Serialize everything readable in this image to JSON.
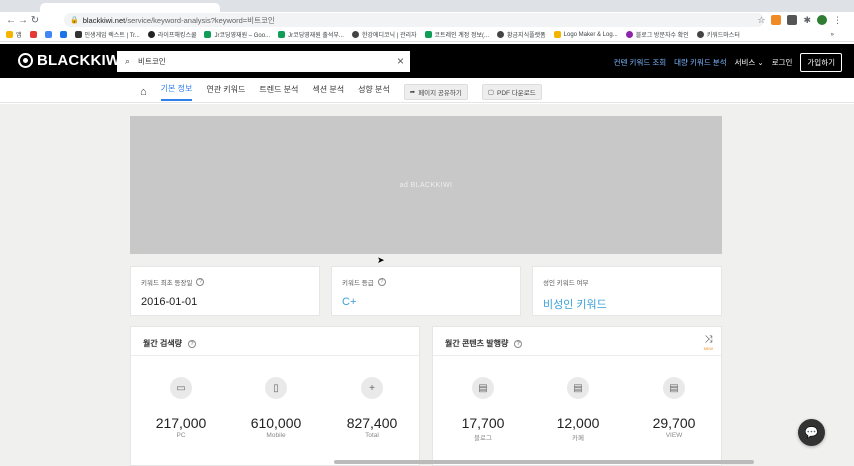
{
  "browser": {
    "url_domain": "blackkiwi.net",
    "url_path": "/service/keyword-analysis?keyword=비트코인",
    "bookmarks": [
      "앱",
      "인생게임 렉스트 | Tr...",
      "라이프해킹스쿨",
      "Jr코딩영재원 – Goo...",
      "Jr코딩영재원 출석부...",
      "한강에디코닉 | 관리자",
      "코트레인 계정 정보(...",
      "황금지식플랫폼",
      "Logo Maker & Log...",
      "블로그 방문자수 확인",
      "키워드마스터"
    ],
    "more_label": "»"
  },
  "header": {
    "logo_text": "BLACKKIWI",
    "search_value": "비트코인",
    "links": [
      "컨텐 키워드 조회",
      "대량 키워드 분석",
      "서비스 ⌄",
      "로그인"
    ],
    "join_label": "가입하기"
  },
  "tabs": {
    "items": [
      "기본 정보",
      "연관 키워드",
      "트렌드 분석",
      "섹션 분석",
      "성향 분석"
    ],
    "active_index": 0,
    "share_label": "페이지 공유하기",
    "pdf_label": "PDF 다운로드"
  },
  "ad": {
    "label": "ad BLACKKIWI"
  },
  "info_cards": [
    {
      "label": "키워드 최초 등장일",
      "value": "2016-01-01"
    },
    {
      "label": "키워드 등급",
      "value": "C+"
    },
    {
      "label": "성인 키워드 여부",
      "value": "비성인 키워드"
    }
  ],
  "monthly_search": {
    "title": "월간 검색량",
    "stats": [
      {
        "icon": "desktop-icon",
        "value": "217,000",
        "caption": "PC"
      },
      {
        "icon": "mobile-icon",
        "value": "610,000",
        "caption": "Mobile"
      },
      {
        "icon": "plus-icon",
        "value": "827,400",
        "caption": "Total"
      }
    ]
  },
  "monthly_content": {
    "title": "월간 콘텐츠 발행량",
    "new_badge": "NEW",
    "stats": [
      {
        "icon": "document-icon",
        "value": "17,700",
        "caption": "블로그"
      },
      {
        "icon": "document-icon",
        "value": "12,000",
        "caption": "카페"
      },
      {
        "icon": "document-icon",
        "value": "29,700",
        "caption": "VIEW"
      }
    ]
  },
  "colors": {
    "accent": "#2f80ed",
    "header_bg": "#000000",
    "link_blue": "#39a0d8"
  }
}
